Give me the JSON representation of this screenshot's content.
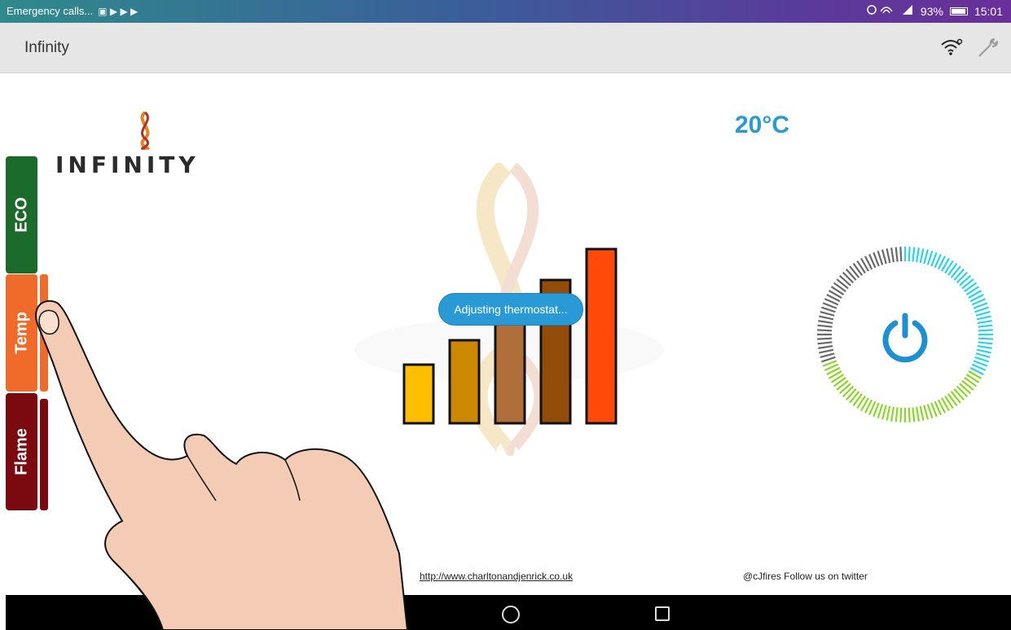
{
  "status_bar": {
    "left_text": "Emergency calls...",
    "left_glyphs": "▣ ▶ ▶ ▶",
    "battery_percent": "93%",
    "time": "15:01"
  },
  "app_bar": {
    "title": "Infinity",
    "icons": [
      "wifi-icon",
      "wrench-icon"
    ]
  },
  "logo": {
    "text": "INFINITY"
  },
  "side_tabs": [
    {
      "label": "ECO",
      "color": "#1c6b2d"
    },
    {
      "label": "Temp",
      "color": "#f06a2a"
    },
    {
      "label": "Flame",
      "color": "#7a0a10"
    }
  ],
  "flame_level": {
    "max_level": 5,
    "bar_colors": [
      "#ffbf00",
      "#cc8800",
      "#b06f3a",
      "#944c0a",
      "#ff4a0a"
    ]
  },
  "toast": {
    "text": "Adjusting thermostat..."
  },
  "temperature": {
    "value": "20°C"
  },
  "power_dial": {
    "colors": {
      "cold": "#2ad4e6",
      "warm": "#8ad62a",
      "inactive": "#6a6a6a",
      "button": "#1e8fd0"
    }
  },
  "footer": {
    "link": "http://www.charltonandjenrick.co.uk",
    "twitter": "@cJfires Follow us on twitter"
  },
  "nav_bar": {
    "buttons": [
      "home-button",
      "recent-apps-button"
    ]
  }
}
